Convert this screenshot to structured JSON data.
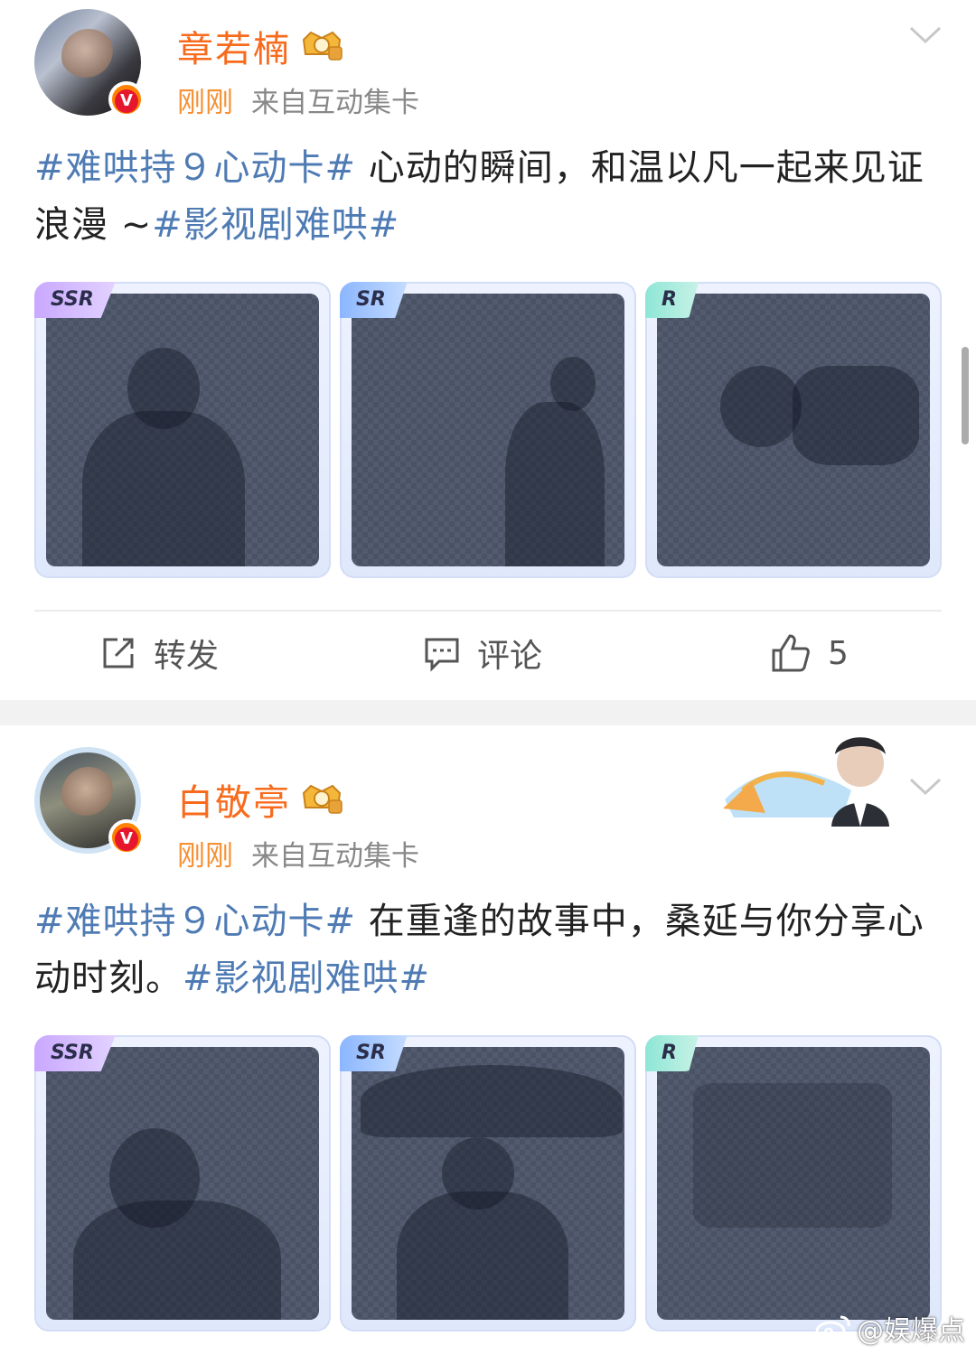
{
  "posts": [
    {
      "username": "章若楠",
      "time": "刚刚",
      "source": "来自互动集卡",
      "text": {
        "tag_prefix": "#难哄持９心动卡#",
        "body": " 心动的瞬间，和温以凡一起来见证浪漫 ~",
        "tag_suffix": "#影视剧难哄#"
      },
      "cards": [
        "SSR",
        "SR",
        "R"
      ],
      "actions": {
        "repost": "转发",
        "comment": "评论",
        "likes": "5"
      }
    },
    {
      "username": "白敬亭",
      "time": "刚刚",
      "source": "来自互动集卡",
      "text": {
        "tag_prefix": "#难哄持９心动卡#",
        "body": " 在重逢的故事中，桑延与你分享心动时刻。",
        "tag_suffix": "#影视剧难哄#"
      },
      "cards": [
        "SSR",
        "SR",
        "R"
      ]
    }
  ],
  "verified_badge": "V",
  "watermark": "@娱爆点",
  "icons": [
    "verified-badge-icon",
    "crown-medal-icon",
    "chevron-down-icon",
    "repost-icon",
    "comment-icon",
    "like-icon",
    "weibo-logo-icon"
  ],
  "colors": {
    "username": "#f86b1d",
    "time": "#f89034",
    "hashtag": "#4f7bb4",
    "separator": "#f2f2f2"
  }
}
